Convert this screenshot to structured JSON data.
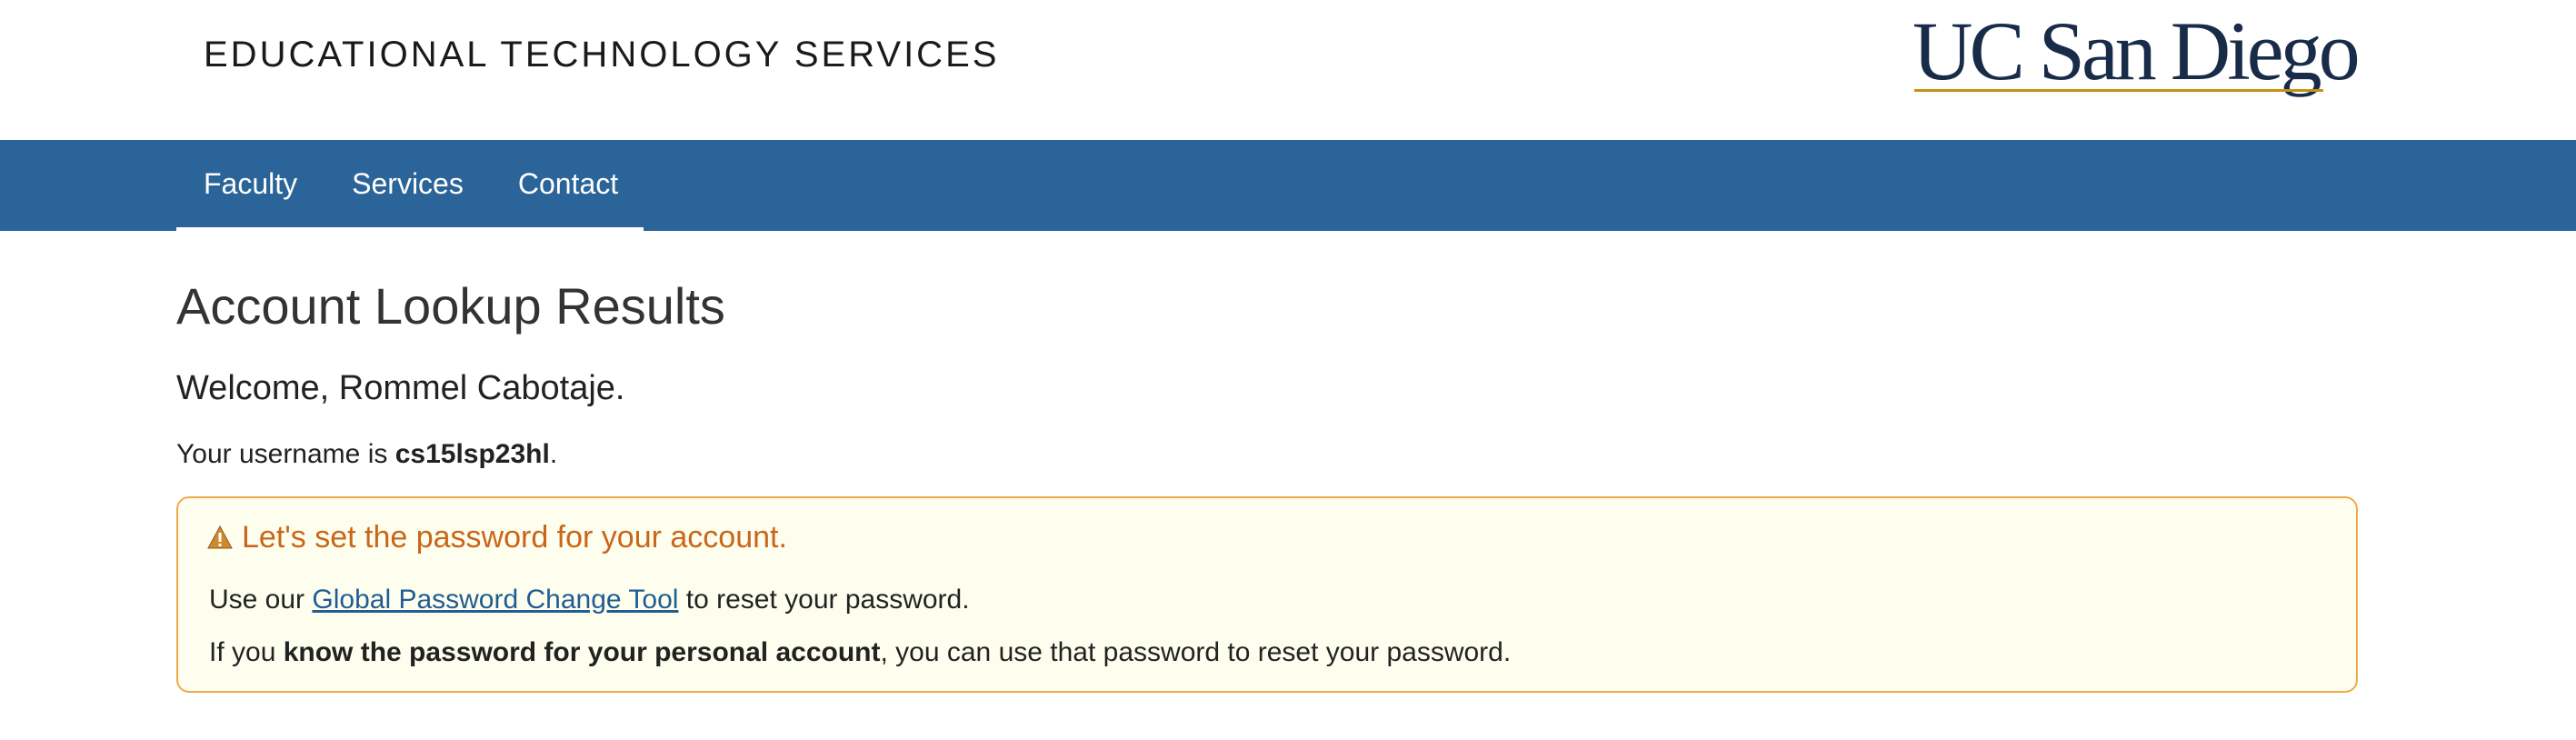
{
  "header": {
    "site_title": "EDUCATIONAL TECHNOLOGY SERVICES",
    "logo_text": "UC San Diego"
  },
  "nav": {
    "items": [
      {
        "label": "Faculty"
      },
      {
        "label": "Services"
      },
      {
        "label": "Contact"
      }
    ]
  },
  "main": {
    "page_title": "Account Lookup Results",
    "welcome": "Welcome, Rommel Cabotaje.",
    "username_prefix": "Your username is ",
    "username": "cs15lsp23hl",
    "username_suffix": "."
  },
  "alert": {
    "icon": "warning-icon",
    "heading": "Let's set the password for your account.",
    "line1_prefix": "Use our ",
    "line1_link": "Global Password Change Tool",
    "line1_suffix": " to reset your password.",
    "line2_prefix": "If you ",
    "line2_bold": "know the password for your personal account",
    "line2_suffix": ", you can use that password to reset your password."
  },
  "colors": {
    "nav_background": "#2b6499",
    "logo_navy": "#182b49",
    "logo_gold": "#c69214",
    "alert_border": "#f1a84b",
    "alert_background": "#fefeee",
    "alert_heading": "#c9661a",
    "link": "#1f5d94"
  }
}
